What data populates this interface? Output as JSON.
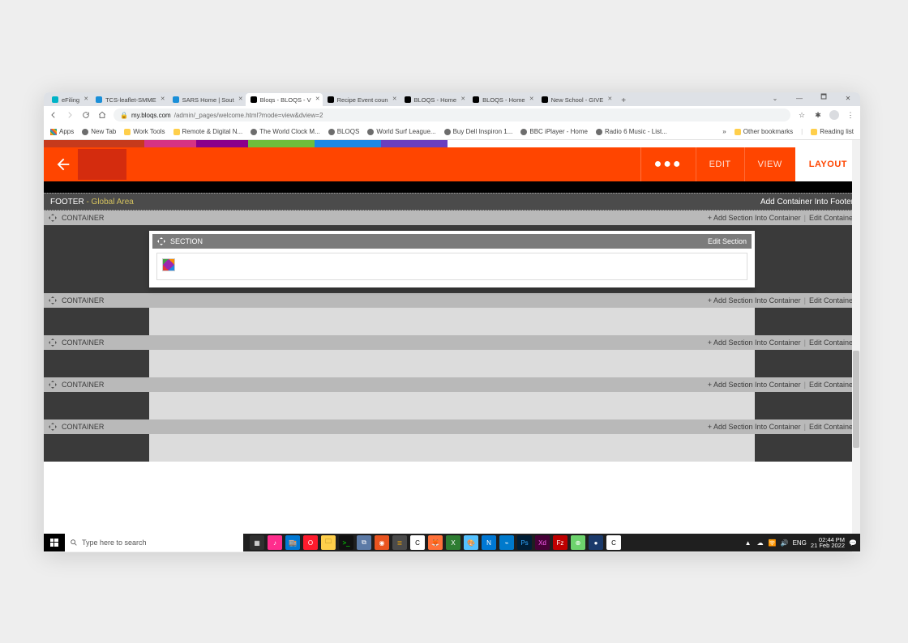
{
  "window_controls": {
    "min": "—",
    "max": "🗖",
    "close": "✕"
  },
  "tabs": [
    {
      "label": "eFiling",
      "favcolor": "#00b3c7"
    },
    {
      "label": "TCS-leaflet-SMME",
      "favcolor": "#1a8fd8"
    },
    {
      "label": "SARS Home | Sout",
      "favcolor": "#1a8fd8"
    },
    {
      "label": "Bloqs - BLOQS - V",
      "favcolor": "#000",
      "active": true
    },
    {
      "label": "Recipe Event coun",
      "favcolor": "#000"
    },
    {
      "label": "BLOQS - Home",
      "favcolor": "#000"
    },
    {
      "label": "BLOQS - Home",
      "favcolor": "#000"
    },
    {
      "label": "New School - GIVE",
      "favcolor": "#000"
    }
  ],
  "tabs_chevron": "⌄",
  "newtab": "+",
  "url": {
    "lock": "🔒",
    "host": "my.bloqs.com",
    "path": "/admin/_pages/welcome.html?mode=view&dview=2"
  },
  "addr_icons": {
    "star": "☆",
    "ext": "✱",
    "menu": "⋮"
  },
  "bookmarks_left": [
    {
      "label": "Apps",
      "kind": "apps"
    },
    {
      "label": "New Tab",
      "kind": "globe"
    },
    {
      "label": "Work Tools",
      "kind": "folder"
    },
    {
      "label": "Remote & Digital N...",
      "kind": "folder"
    },
    {
      "label": "The World Clock M...",
      "kind": "globe"
    },
    {
      "label": "BLOQS",
      "kind": "globe"
    },
    {
      "label": "World Surf League...",
      "kind": "globe"
    },
    {
      "label": "Buy Dell Inspiron 1...",
      "kind": "globe"
    },
    {
      "label": "BBC iPlayer - Home",
      "kind": "globe"
    },
    {
      "label": "Radio 6 Music - List...",
      "kind": "globe"
    }
  ],
  "bookmarks_overflow": "»",
  "bookmarks_right": [
    {
      "label": "Other bookmarks",
      "kind": "folder"
    },
    {
      "label": "Reading list",
      "kind": "folder"
    }
  ],
  "header": {
    "modes": {
      "dots": "●●●",
      "edit": "EDIT",
      "view": "VIEW",
      "layout": "LAYOUT"
    }
  },
  "footer_row": {
    "title": "FOOTER",
    "suffix": " - Global Area",
    "action": "Add Container Into Footer"
  },
  "container": {
    "label": "CONTAINER",
    "add": "+ Add Section Into Container",
    "edit": "Edit Container",
    "sep": "|"
  },
  "section": {
    "label": "SECTION",
    "edit": "Edit Section"
  },
  "num_plain_containers": 4,
  "search_placeholder": "Type here to search",
  "task_icons": [
    {
      "bg": "#303030",
      "fg": "#fff",
      "g": "▦"
    },
    {
      "bg": "#ff2d8d",
      "fg": "#fff",
      "g": "♪"
    },
    {
      "bg": "#0078d4",
      "fg": "#fff",
      "g": "🏬"
    },
    {
      "bg": "#ff1b2d",
      "fg": "#fff",
      "g": "O"
    },
    {
      "bg": "#ffcf4b",
      "fg": "#7a5900",
      "g": "🗀"
    },
    {
      "bg": "#111",
      "fg": "#0f0",
      "g": ">_"
    },
    {
      "bg": "#5c7aa6",
      "fg": "#fff",
      "g": "⧉"
    },
    {
      "bg": "#e95420",
      "fg": "#fff",
      "g": "◉"
    },
    {
      "bg": "#4b4b4b",
      "fg": "#ffae00",
      "g": "≣"
    },
    {
      "bg": "#fff",
      "fg": "#000",
      "g": "C"
    },
    {
      "bg": "#ff7139",
      "fg": "#fff",
      "g": "🦊"
    },
    {
      "bg": "#2e7d32",
      "fg": "#fff",
      "g": "X"
    },
    {
      "bg": "#55c2ff",
      "fg": "#fff",
      "g": "🎨"
    },
    {
      "bg": "#0078d4",
      "fg": "#fff",
      "g": "N"
    },
    {
      "bg": "#007acc",
      "fg": "#fff",
      "g": "⌁"
    },
    {
      "bg": "#001e36",
      "fg": "#31a8ff",
      "g": "Ps"
    },
    {
      "bg": "#470137",
      "fg": "#ff61f6",
      "g": "Xd"
    },
    {
      "bg": "#bf0000",
      "fg": "#fff",
      "g": "Fz"
    },
    {
      "bg": "#6dd36d",
      "fg": "#fff",
      "g": "⊕"
    },
    {
      "bg": "#1b3a6b",
      "fg": "#fff",
      "g": "●"
    },
    {
      "bg": "#fff",
      "fg": "#000",
      "g": "C"
    }
  ],
  "tray": {
    "icons": [
      "▲",
      "☁",
      "🛜",
      "🔊"
    ],
    "lang": "ENG",
    "time": "02:44 PM",
    "date": "21 Feb 2022",
    "notif": "💬"
  }
}
